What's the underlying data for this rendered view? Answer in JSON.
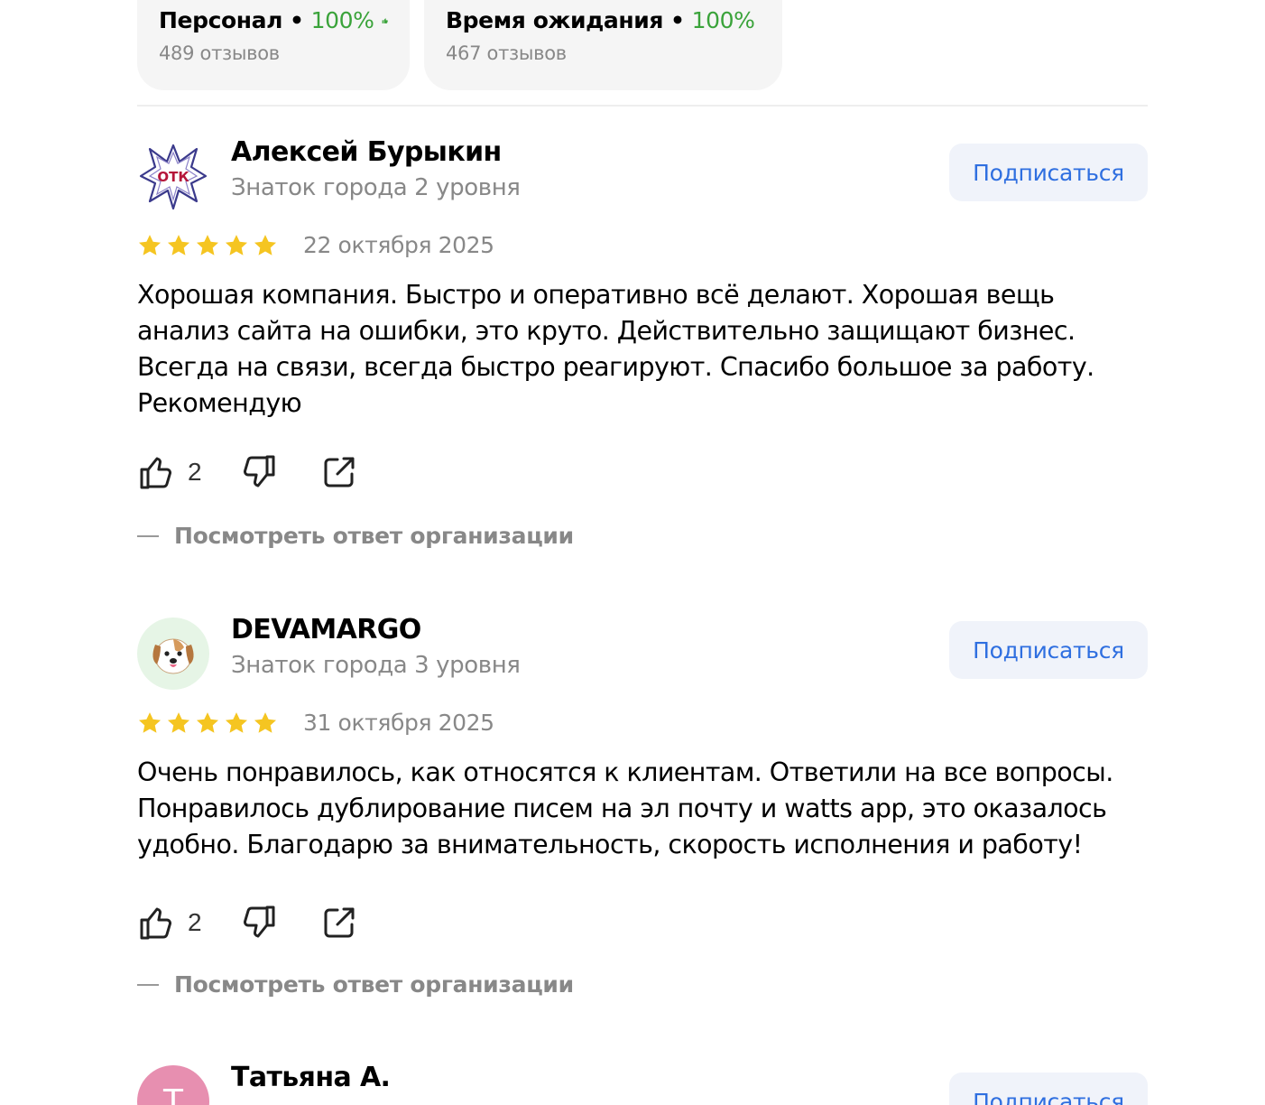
{
  "aspects": [
    {
      "name": "Персонал",
      "percent": "100%",
      "count": "489 отзывов"
    },
    {
      "name": "Время ожидания",
      "percent": "100%",
      "count": "467 отзывов"
    }
  ],
  "icons": {
    "thumb": "thumbs-up-icon",
    "star": "star-icon",
    "like": "thumbs-up-outline-icon",
    "dislike": "thumbs-down-outline-icon",
    "share": "share-icon"
  },
  "colors": {
    "accent_green": "#3aa33a",
    "link_blue": "#2f6fe0",
    "star_yellow": "#f5c521",
    "muted": "#888888"
  },
  "reviews": [
    {
      "author": "Алексей Бурыкин",
      "level": "Знаток города 2 уровня",
      "subscribe": "Подписаться",
      "rating": 5,
      "date": "22 октября 2025",
      "text": "Хорошая компания. Быстро и оперативно всё делают. Хорошая вещь анализ сайта на ошибки, это круто. Действительно защищают бизнес. Всегда на связи, всегда быстро реагируют. Спасибо большое за работу. Рекомендую",
      "likes": "2",
      "org_answer": "Посмотреть ответ организации",
      "avatar_text": "ОТК"
    },
    {
      "author": "DEVAMARGO",
      "level": "Знаток города 3 уровня",
      "subscribe": "Подписаться",
      "rating": 5,
      "date": "31 октября 2025",
      "text": "Очень понравилось, как относятся к клиентам. Ответили на все вопросы. Понравилось дублирование писем на эл почту и watts app, это оказалось удобно. Благодарю за внимательность, скорость исполнения и работу!",
      "likes": "2",
      "org_answer": "Посмотреть ответ организации",
      "avatar_emoji": "🐶"
    },
    {
      "author": "Татьяна А.",
      "subscribe": "Подписаться",
      "avatar_letter": "Т"
    }
  ]
}
